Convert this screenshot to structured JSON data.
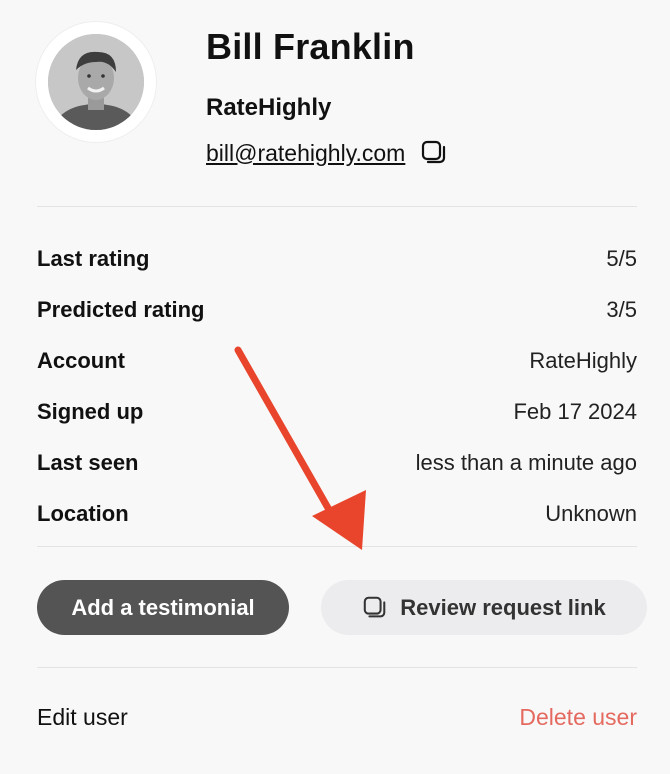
{
  "user": {
    "name": "Bill Franklin",
    "company": "RateHighly",
    "email": "bill@ratehighly.com"
  },
  "details": [
    {
      "label": "Last rating",
      "value": "5/5"
    },
    {
      "label": "Predicted rating",
      "value": "3/5"
    },
    {
      "label": "Account",
      "value": "RateHighly"
    },
    {
      "label": "Signed up",
      "value": "Feb 17 2024"
    },
    {
      "label": "Last seen",
      "value": "less than a minute ago"
    },
    {
      "label": "Location",
      "value": "Unknown"
    }
  ],
  "actions": {
    "add_testimonial": "Add a testimonial",
    "review_request_link": "Review request link"
  },
  "footer": {
    "edit": "Edit user",
    "delete": "Delete user"
  },
  "icons": {
    "copy": "copy-icon",
    "arrow": "arrow-annotation"
  },
  "colors": {
    "primary_button": "#545454",
    "secondary_button": "#ececee",
    "danger": "#e46a60",
    "annotation_arrow": "#e8452c"
  }
}
